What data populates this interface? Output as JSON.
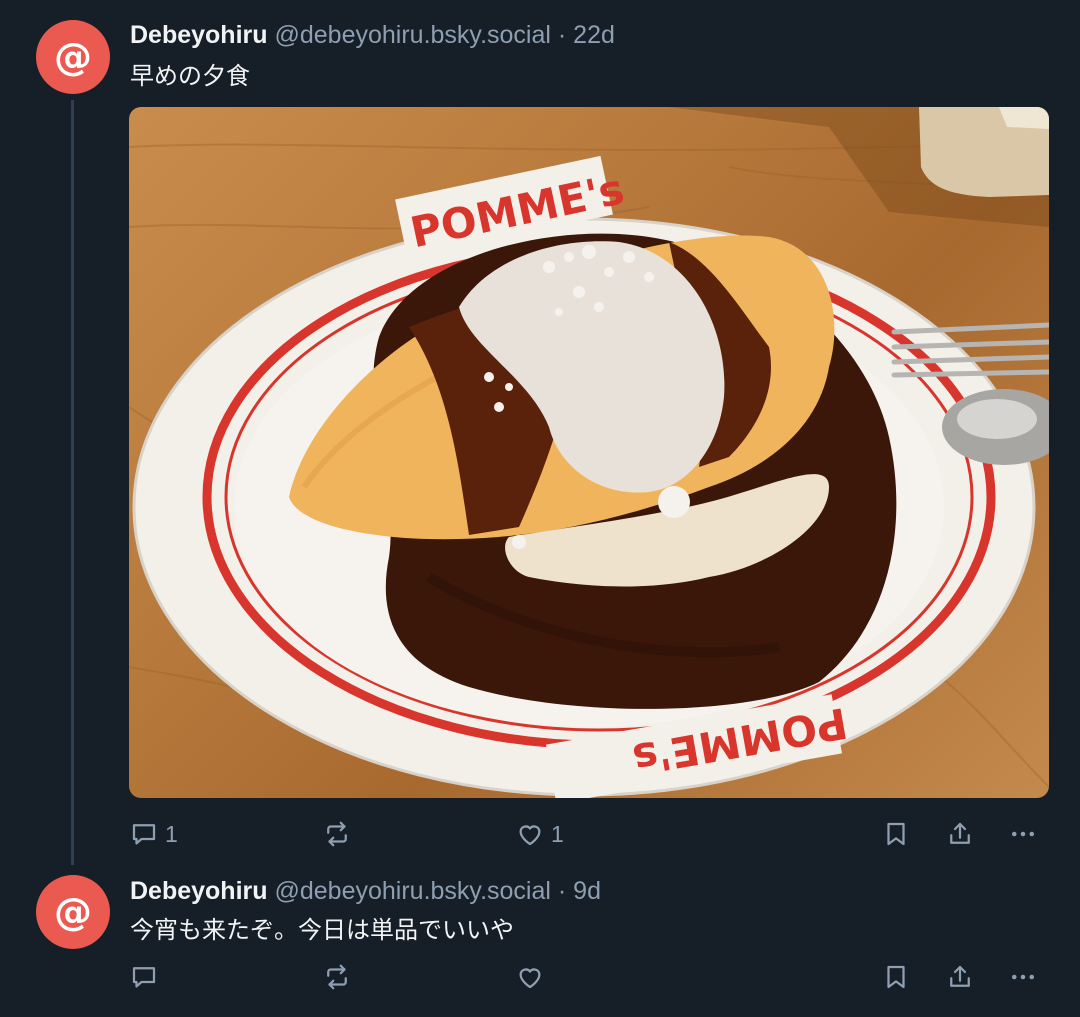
{
  "posts": [
    {
      "author": "Debeyohiru",
      "handle": "@debeyohiru.bsky.social",
      "separator": "·",
      "time": "22d",
      "text": "早めの夕食",
      "image": {
        "plate_text_top": "POMME's",
        "plate_text_bottom": "POMME's"
      },
      "replies": "1",
      "reposts": "",
      "likes": "1"
    },
    {
      "author": "Debeyohiru",
      "handle": "@debeyohiru.bsky.social",
      "separator": "·",
      "time": "9d",
      "text": "今宵も来たぞ。今日は単品でいいや",
      "replies": "",
      "reposts": "",
      "likes": ""
    }
  ],
  "avatar_glyph": "@",
  "colors": {
    "background": "#161e27",
    "avatar": "#ea5a50",
    "muted": "#8d9fb1",
    "thread_line": "#2e4052"
  }
}
